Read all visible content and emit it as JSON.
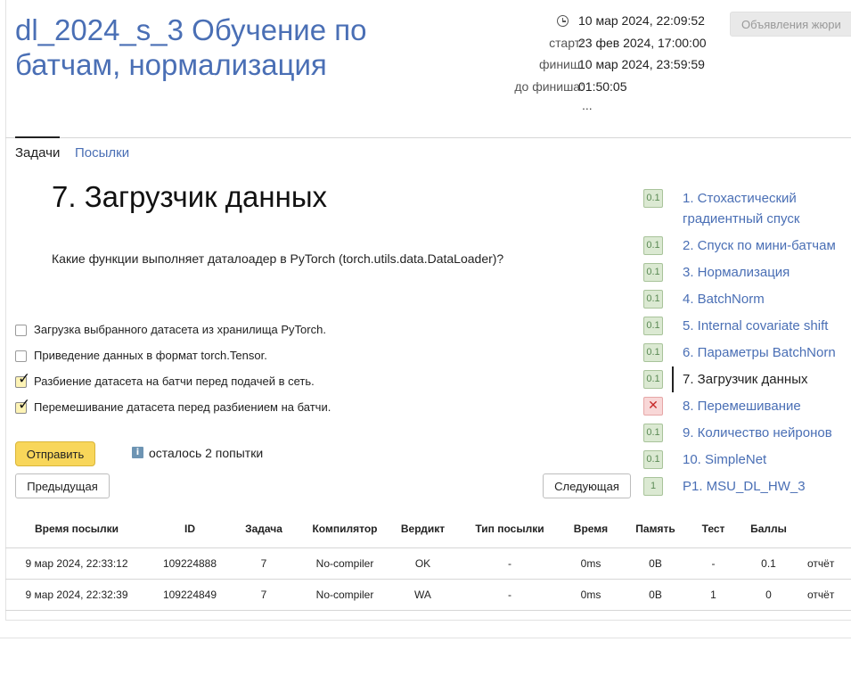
{
  "contest": {
    "title": "dl_2024_s_3 Обучение по батчам, нормализация",
    "now": "10 мар 2024, 22:09:52",
    "start_label": "старт:",
    "start": "23 фев 2024, 17:00:00",
    "finish_label": "финиш:",
    "finish": "10 мар 2024, 23:59:59",
    "remaining_label": "до финиша:",
    "remaining": "01:50:05",
    "more": "...",
    "jury_button": "Объявления жюри"
  },
  "tabs": [
    {
      "label": "Задачи",
      "active": true
    },
    {
      "label": "Посылки",
      "active": false
    }
  ],
  "problem": {
    "title": "7. Загрузчик данных",
    "question": "Какие функции выполняет даталоадер в PyTorch (torch.utils.data.DataLoader)?",
    "options": [
      {
        "label": "Загрузка выбранного датасета из хранилища PyTorch.",
        "checked": false
      },
      {
        "label": "Приведение данных в формат torch.Tensor.",
        "checked": false
      },
      {
        "label": "Разбиение датасета на батчи перед подачей в сеть.",
        "checked": true
      },
      {
        "label": "Перемешивание датасета перед разбиением на батчи.",
        "checked": true
      }
    ],
    "check_mark": "✓",
    "submit_label": "Отправить",
    "info_icon": "i",
    "attempts_left": "осталось 2 попытки",
    "prev_label": "Предыдущая",
    "next_label": "Следующая"
  },
  "problem_list": [
    {
      "score": "0.1",
      "title": "1. Стохастический градиентный спуск",
      "status": "ok"
    },
    {
      "score": "0.1",
      "title": "2. Спуск по мини-батчам",
      "status": "ok"
    },
    {
      "score": "0.1",
      "title": "3. Нормализация",
      "status": "ok"
    },
    {
      "score": "0.1",
      "title": "4. BatchNorm",
      "status": "ok"
    },
    {
      "score": "0.1",
      "title": "5. Internal covariate shift",
      "status": "ok"
    },
    {
      "score": "0.1",
      "title": "6. Параметры BatchNorn",
      "status": "ok"
    },
    {
      "score": "0.1",
      "title": "7. Загрузчик данных",
      "status": "ok",
      "current": true
    },
    {
      "score": "✕",
      "title": "8. Перемешивание",
      "status": "fail"
    },
    {
      "score": "0.1",
      "title": "9. Количество нейронов",
      "status": "ok"
    },
    {
      "score": "0.1",
      "title": "10. SimpleNet",
      "status": "ok"
    },
    {
      "score": "1",
      "title": "P1. MSU_DL_HW_3",
      "status": "ok"
    }
  ],
  "submissions": {
    "headers": [
      "Время посылки",
      "ID",
      "Задача",
      "Компилятор",
      "Вердикт",
      "Тип посылки",
      "Время",
      "Память",
      "Тест",
      "Баллы",
      ""
    ],
    "rows": [
      [
        "9 мар 2024, 22:33:12",
        "109224888",
        "7",
        "No-compiler",
        "OK",
        "-",
        "0ms",
        "0B",
        "-",
        "0.1",
        "отчёт"
      ],
      [
        "9 мар 2024, 22:32:39",
        "109224849",
        "7",
        "No-compiler",
        "WA",
        "-",
        "0ms",
        "0B",
        "1",
        "0",
        "отчёт"
      ]
    ]
  },
  "colors": {
    "link": "#4a6fb5",
    "accent": "#f8d65a",
    "ok": "#3d8a3d",
    "wa": "#d33b3b"
  }
}
